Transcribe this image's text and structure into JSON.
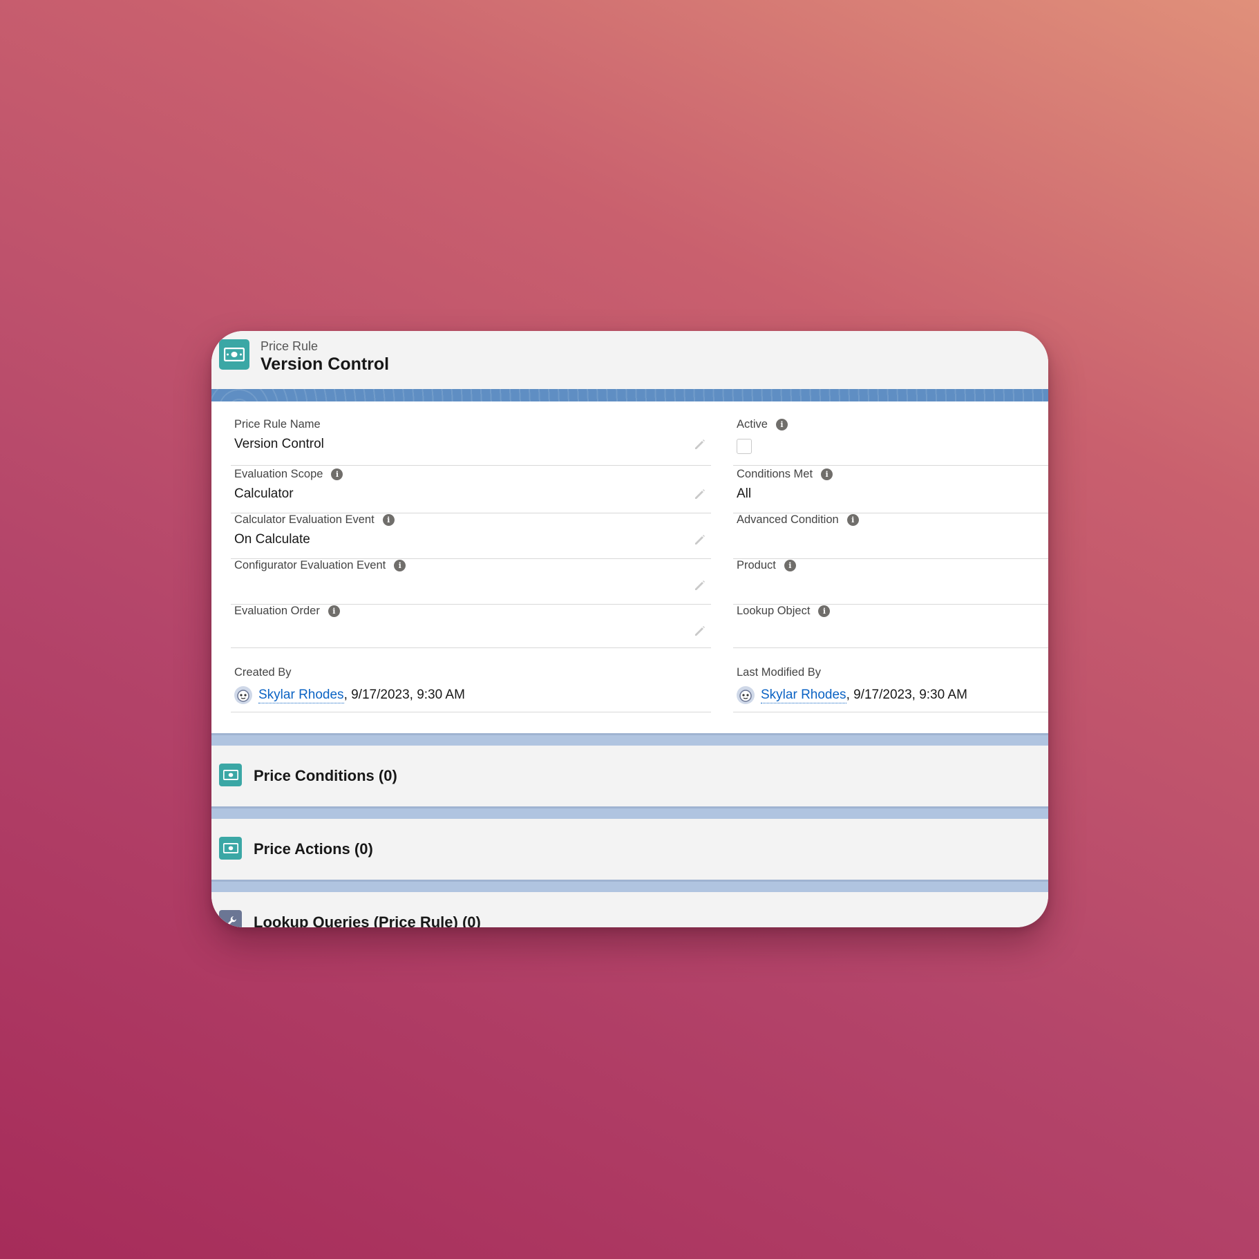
{
  "header": {
    "object_type": "Price Rule",
    "record_title": "Version Control",
    "icon": "money-icon",
    "accent": "#3ba7a5"
  },
  "left_fields": [
    {
      "label": "Price Rule Name",
      "value": "Version Control",
      "info": false
    },
    {
      "label": "Evaluation Scope",
      "value": "Calculator",
      "info": true
    },
    {
      "label": "Calculator Evaluation Event",
      "value": "On Calculate",
      "info": true
    },
    {
      "label": "Configurator Evaluation Event",
      "value": "",
      "info": true
    },
    {
      "label": "Evaluation Order",
      "value": "",
      "info": true
    }
  ],
  "right_fields": [
    {
      "label": "Active",
      "value": "",
      "info": true,
      "checkbox": false
    },
    {
      "label": "Conditions Met",
      "value": "All",
      "info": true
    },
    {
      "label": "Advanced Condition",
      "value": "",
      "info": true
    },
    {
      "label": "Product",
      "value": "",
      "info": true
    },
    {
      "label": "Lookup Object",
      "value": "",
      "info": true
    }
  ],
  "system": {
    "created_by_label": "Created By",
    "created_by_user": "Skylar Rhodes",
    "created_by_date": ", 9/17/2023, 9:30 AM",
    "modified_by_label": "Last Modified By",
    "modified_by_user": "Skylar Rhodes",
    "modified_by_date": ", 9/17/2023, 9:30 AM"
  },
  "related_lists": [
    {
      "title": "Price Conditions (0)",
      "icon": "money-icon"
    },
    {
      "title": "Price Actions (0)",
      "icon": "money-icon"
    },
    {
      "title": "Lookup Queries (Price Rule) (0)",
      "icon": "wrench-icon"
    }
  ],
  "info_glyph": "i"
}
